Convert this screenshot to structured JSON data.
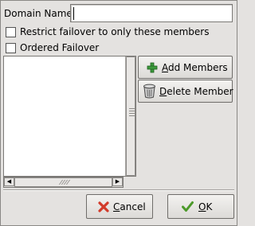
{
  "domain_name": {
    "label": "Domain Name",
    "value": ""
  },
  "restrict_failover": {
    "label": "Restrict failover to only these members",
    "checked": false
  },
  "ordered_failover": {
    "label": "Ordered Failover",
    "checked": false
  },
  "members_list": {
    "items": []
  },
  "buttons": {
    "add_members": {
      "mnemonic": "A",
      "rest": "dd Members",
      "icon": "plus-icon"
    },
    "delete_member": {
      "mnemonic": "D",
      "rest": "elete Member",
      "icon": "trash-can-icon"
    },
    "cancel": {
      "mnemonic": "C",
      "rest": "ancel",
      "icon": "cancel-x-icon"
    },
    "ok": {
      "mnemonic": "O",
      "rest": "K",
      "icon": "checkmark-icon"
    }
  },
  "colors": {
    "background": "#e4e2e0",
    "add_icon_green": "#3c9a3c",
    "cancel_icon_red": "#d23b2a",
    "ok_icon_green": "#4c9a2a"
  }
}
